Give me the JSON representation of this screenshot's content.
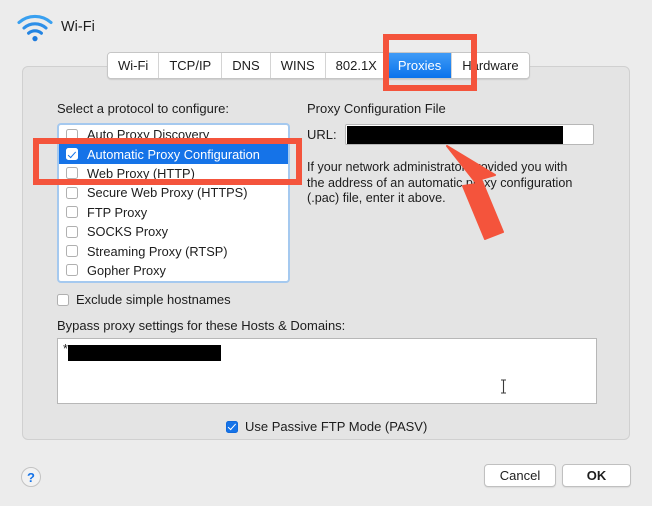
{
  "window": {
    "title": "Wi-Fi",
    "icon": "wifi-icon"
  },
  "tabs": [
    {
      "label": "Wi-Fi",
      "active": false
    },
    {
      "label": "TCP/IP",
      "active": false
    },
    {
      "label": "DNS",
      "active": false
    },
    {
      "label": "WINS",
      "active": false
    },
    {
      "label": "802.1X",
      "active": false
    },
    {
      "label": "Proxies",
      "active": true
    },
    {
      "label": "Hardware",
      "active": false
    }
  ],
  "protocols": {
    "label": "Select a protocol to configure:",
    "items": [
      {
        "label": "Auto Proxy Discovery",
        "checked": false,
        "selected": false
      },
      {
        "label": "Automatic Proxy Configuration",
        "checked": true,
        "selected": true
      },
      {
        "label": "Web Proxy (HTTP)",
        "checked": false,
        "selected": false
      },
      {
        "label": "Secure Web Proxy (HTTPS)",
        "checked": false,
        "selected": false
      },
      {
        "label": "FTP Proxy",
        "checked": false,
        "selected": false
      },
      {
        "label": "SOCKS Proxy",
        "checked": false,
        "selected": false
      },
      {
        "label": "Streaming Proxy (RTSP)",
        "checked": false,
        "selected": false
      },
      {
        "label": "Gopher Proxy",
        "checked": false,
        "selected": false
      }
    ]
  },
  "proxy_config": {
    "heading": "Proxy Configuration File",
    "url_label": "URL:",
    "url_value": "",
    "help_text": "If your network administrator provided you with the address of an automatic proxy configuration (.pac) file, enter it above."
  },
  "exclude_simple_hostnames": {
    "label": "Exclude simple hostnames",
    "checked": false
  },
  "bypass": {
    "label": "Bypass proxy settings for these Hosts & Domains:",
    "entry_prefix": "*",
    "entry_value": ""
  },
  "passive_ftp": {
    "label": "Use Passive FTP Mode (PASV)",
    "checked": true
  },
  "footer": {
    "help_glyph": "?",
    "cancel_label": "Cancel",
    "ok_label": "OK"
  },
  "colors": {
    "accent_blue": "#1573e8",
    "annotation_red": "#f4543c",
    "window_bg": "#ececec",
    "panel_bg": "#e4e4e4"
  }
}
